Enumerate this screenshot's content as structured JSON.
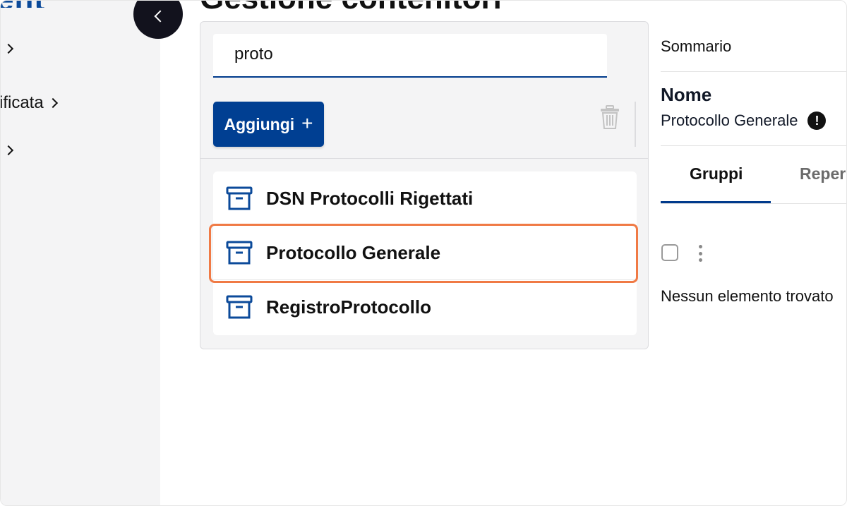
{
  "sidebar": {
    "logo_text": "ent",
    "items": [
      {
        "label": ""
      },
      {
        "label": "ificata"
      },
      {
        "label": ""
      }
    ]
  },
  "page": {
    "title": "Gestione contenitori"
  },
  "search": {
    "value": "proto"
  },
  "toolbar": {
    "add_label": "Aggiungi",
    "add_icon": "plus-icon",
    "delete_icon": "trash-icon"
  },
  "list": {
    "items": [
      {
        "label": "DSN Protocolli Rigettati",
        "icon": "archive-box-icon"
      },
      {
        "label": "Protocollo Generale",
        "icon": "archive-box-icon",
        "selected": true
      },
      {
        "label": "RegistroProtocollo",
        "icon": "archive-box-icon"
      }
    ]
  },
  "details": {
    "summary_title": "Sommario",
    "name_label": "Nome",
    "name_value": "Protocollo Generale",
    "warning_icon": "exclamation-icon",
    "tabs": [
      {
        "label": "Gruppi",
        "active": true
      },
      {
        "label": "Reper",
        "active": false
      }
    ],
    "empty_text": "Nessun elemento trovato"
  },
  "colors": {
    "primary": "#003f92",
    "highlight": "#f07a45",
    "sidebar_bg": "#f4f4f5",
    "dark_button": "#12121d"
  }
}
